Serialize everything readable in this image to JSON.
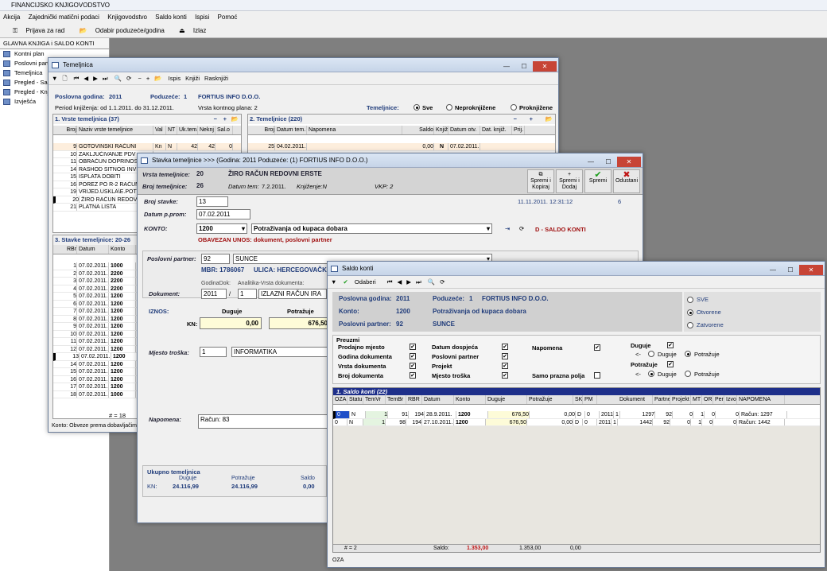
{
  "app": {
    "title": "FINANCIJSKO KNJIGOVODSTVO",
    "menu": [
      "Akcija",
      "Zajednički matični podaci",
      "Knjigovodstvo",
      "Saldo konti",
      "Ispisi",
      "Pomoć"
    ],
    "toolbar": [
      "Prijava za rad",
      "Odabir poduzeće/godina",
      "Izlaz"
    ]
  },
  "left": {
    "title": "GLAVNA KNJIGA i SALDO KONTI",
    "items": [
      "Kontni plan",
      "Poslovni parti",
      "Temeljnica",
      "Pregled - Sald",
      "Pregled - Knjiz",
      "Izvješća"
    ]
  },
  "tem": {
    "title": "Temeljnica",
    "tb": [
      "Ispis",
      "Knjiži",
      "Rasknjiži"
    ],
    "godina_lbl": "Poslovna godina:",
    "godina": "2011",
    "poduzece_lbl": "Poduzeće:",
    "poduzece": "1",
    "firma": "FORTIUS INFO D.O.O.",
    "period": "Period knjiženja: od 1.1.2011. do 31.12.2011.",
    "vrsta_plana": "Vrsta kontnog plana: 2",
    "filter_lbl": "Temeljnice:",
    "filters": [
      "Sve",
      "Neproknjižene",
      "Proknjižene"
    ],
    "vrste_hdr": "1. Vrste temeljnica (37)",
    "vrste_cols": [
      "Broj",
      "Naziv vrste temeljnice",
      "Val",
      "NT",
      "Uk.tem.",
      "Neknj",
      "Sal.o"
    ],
    "vrste": [
      [
        "9",
        "GOTOVINSKI RAČUNI",
        "Kn",
        "N",
        "42",
        "42",
        "0"
      ],
      [
        "10",
        "ZAKLJUČIVANJE PDV",
        "",
        "",
        "",
        "",
        ""
      ],
      [
        "11",
        "OBRAČUN DOPRINOSA",
        "",
        "",
        "",
        "",
        ""
      ],
      [
        "14",
        "RASHOD SITNOG INVE",
        "",
        "",
        "",
        "",
        ""
      ],
      [
        "15",
        "ISPLATA DOBITI",
        "",
        "",
        "",
        "",
        ""
      ],
      [
        "16",
        "POREZ PO R-2 RAČUNI",
        "",
        "",
        "",
        "",
        ""
      ],
      [
        "19",
        "VRIJED.USKLA\\E.POTR",
        "",
        "",
        "",
        "",
        ""
      ],
      [
        "20",
        "ŽIRO RAČUN REDOVNI",
        "",
        "",
        "",
        "",
        ""
      ],
      [
        "21",
        "PLATNA LISTA",
        "",
        "",
        "",
        "",
        ""
      ]
    ],
    "tem_hdr": "2. Temeljnice (220)",
    "tem_cols": [
      "Broj",
      "Datum tem.",
      "Napomena",
      "Saldo",
      "Knjiž.",
      "Datum otv.",
      "Dat. knjiž.",
      "Prij."
    ],
    "tem_row": [
      "25",
      "04.02.2011.",
      "",
      "0,00",
      "N",
      "07.02.2011.",
      "",
      ""
    ],
    "stavke_hdr": "3. Stavke temeljnice: 20-26",
    "stavke_cols": [
      "RBr",
      "Datum",
      "Konto"
    ],
    "stavke": [
      [
        "1",
        "07.02.2011.",
        "1000"
      ],
      [
        "2",
        "07.02.2011.",
        "2200"
      ],
      [
        "3",
        "07.02.2011.",
        "2200"
      ],
      [
        "4",
        "07.02.2011.",
        "2200"
      ],
      [
        "5",
        "07.02.2011.",
        "1200"
      ],
      [
        "6",
        "07.02.2011.",
        "1200"
      ],
      [
        "7",
        "07.02.2011.",
        "1200"
      ],
      [
        "8",
        "07.02.2011.",
        "1200"
      ],
      [
        "9",
        "07.02.2011.",
        "1200"
      ],
      [
        "10",
        "07.02.2011.",
        "1200"
      ],
      [
        "11",
        "07.02.2011.",
        "1200"
      ],
      [
        "12",
        "07.02.2011.",
        "1200"
      ],
      [
        "13",
        "07.02.2011.",
        "1200"
      ],
      [
        "14",
        "07.02.2011.",
        "1200"
      ],
      [
        "15",
        "07.02.2011.",
        "1200"
      ],
      [
        "16",
        "07.02.2011.",
        "1200"
      ],
      [
        "17",
        "07.02.2011.",
        "1200"
      ],
      [
        "18",
        "07.02.2011.",
        "1000"
      ]
    ],
    "count": "# = 18",
    "status": "Konto: Obveze prema dobavljačim"
  },
  "stav": {
    "title": "Stavka temeljnice   >>>   (Godina: 2011   Poduzeće: (1) FORTIUS INFO D.O.O.)",
    "vrsta_lbl": "Vrsta temeljnice:",
    "vrsta": "20",
    "vrsta_naziv": "ŽIRO RAČUN REDOVNI ERSTE",
    "broj_lbl": "Broj temeljnice:",
    "broj": "26",
    "datum_lbl": "Datum tem:",
    "datum": "7.2.2011.",
    "knjizenje": "Knjiženje:N",
    "vkp": "VKP: 2",
    "btns": [
      "Spremi i Kopiraj",
      "Spremi i Dodaj",
      "Spremi",
      "Odustani"
    ],
    "broj_stavke_lbl": "Broj stavke:",
    "broj_stavke": "13",
    "datum_prom_lbl": "Datum p.prom:",
    "datum_prom": "07.02.2011",
    "ts": "11.11.2011. 12:31:12",
    "ts_n": "6",
    "konto_lbl": "KONTO:",
    "konto": "1200",
    "konto_naziv": "Potraživanja od kupaca dobara",
    "konto_tip": "D - SALDO KONTI",
    "obavezan": "OBAVEZAN UNOS: dokument, poslovni partner",
    "partner_lbl": "Poslovni partner:",
    "partner": "92",
    "partner_naziv": "SUNCE",
    "mbr": "MBR: 1786067",
    "ulica": "ULICA: HERCEGOVAČK",
    "dok_lbl": "Dokument:",
    "godinadok_lbl": "GodinaDok:",
    "godinadok": "2011",
    "anal_lbl": "Analitika-Vrsta dokumenta:",
    "anal": "1",
    "anal_naziv": "IZLAZNI RAČUN IRA",
    "iznos_lbl": "IZNOS:",
    "duguje_lbl": "Duguje",
    "potrazuje_lbl": "Potražuje",
    "kn": "KN:",
    "duguje": "0,00",
    "potrazuje": "676,50",
    "mt_lbl": "Mjesto troška:",
    "mt": "1",
    "mt_naziv": "INFORMATIKA",
    "nap_lbl": "Napomena:",
    "nap": "Račun: 83",
    "uk_lbl": "Ukupno temeljnica",
    "uk_kn": "KN:",
    "uk_duguje": "24.116,99",
    "uk_potrazuje": "24.116,99",
    "uk_saldo": "0,00",
    "uk_saldo_lbl": "Saldo"
  },
  "sk": {
    "title": "Saldo konti",
    "tb_odaberi": "Odaberi",
    "godina_lbl": "Poslovna godina:",
    "godina": "2011",
    "poduzece_lbl": "Poduzeće:",
    "poduzece": "1",
    "firma": "FORTIUS INFO D.O.O.",
    "konto_lbl": "Konto:",
    "konto": "1200",
    "konto_naziv": "Potraživanja od kupaca dobara",
    "partner_lbl": "Poslovni partner:",
    "partner": "92",
    "partner_naziv": "SUNCE",
    "opts": [
      "SVE",
      "Otvorene",
      "Zatvorene"
    ],
    "preuzmi": "Preuzmi",
    "col1": [
      "Prodajno mjesto",
      "Godina dokumenta",
      "Vrsta dokumenta",
      "Broj dokumenta"
    ],
    "col2": [
      "Datum dospjeća",
      "Poslovni partner",
      "Projekt",
      "Mjesto troška"
    ],
    "col3": [
      "Napomena",
      "Samo prazna polja"
    ],
    "duguje_lbl": "Duguje",
    "potrazuje_lbl": "Potražuje",
    "arrow": "<-",
    "r_duguje": "Duguje",
    "r_potrazuje": "Potražuje",
    "grid_hdr": "1. Saldo konti  (22)",
    "cols": [
      "OZA",
      "Statu",
      "TemVr",
      "TemBr",
      "RBR",
      "Datum",
      "Konto",
      "Duguje",
      "Potražuje",
      "SK",
      "PM",
      "",
      "",
      "Dokument",
      "Partner",
      "Projekt",
      "MT",
      "OR",
      "Peri",
      "Izvor",
      "NAPOMENA"
    ],
    "rows": [
      [
        "0",
        "N",
        "1",
        "91",
        "194",
        "28.9.2011.",
        "1200",
        "676,50",
        "0,00",
        "D",
        "0",
        "2011",
        "1",
        "1297",
        "92",
        "0",
        "1",
        "0",
        "",
        "0",
        "Račun: 1297"
      ],
      [
        "0",
        "N",
        "1",
        "98",
        "194",
        "27.10.2011.",
        "1200",
        "676,50",
        "0,00",
        "D",
        "0",
        "2011",
        "1",
        "1442",
        "92",
        "0",
        "1",
        "0",
        "",
        "0",
        "Račun: 1442"
      ]
    ],
    "foot_count": "# = 2",
    "foot_saldo_lbl": "Saldo:",
    "foot_saldo": "1.353,00",
    "foot_dug": "1.353,00",
    "foot_pot": "0,00",
    "status": "OZA"
  }
}
